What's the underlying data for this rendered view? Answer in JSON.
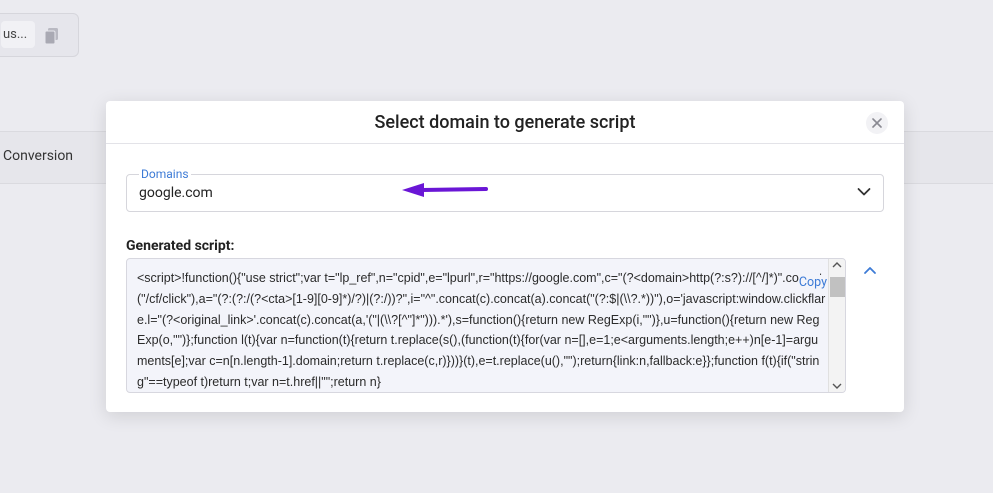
{
  "background": {
    "field_text": "us...",
    "row_label": "Conversion"
  },
  "modal": {
    "title": "Select domain to generate script",
    "domains_label": "Domains",
    "selected_domain": "google.com",
    "generated_label": "Generated script:",
    "copy_label": "Copy",
    "script_text": "<script>!function(){\"use strict\";var t=\"lp_ref\",n=\"cpid\",e=\"lpurl\",r=\"https://google.com\",c=\"(?<domain>http(?:s?)://[^/]*)\".concat(\"/cf/click\"),a=\"(?:(?:/(?<cta>[1-9][0-9]*)/?)|(?:/))?\",i=\"^\".concat(c).concat(a).concat(\"(?:$|(\\\\?.*))\"),o='javascript:window.clickflare.l=\"(?<original_link>'.concat(c).concat(a,'(\"|(\\\\?[^\"]*\"))).*'),s=function(){return new RegExp(i,\"\")},u=function(){return new RegExp(o,\"\")};function l(t){var n=function(t){return t.replace(s(),(function(t){for(var n=[],e=1;e<arguments.length;e++)n[e-1]=arguments[e];var c=n[n.length-1].domain;return t.replace(c,r)}))}(t),e=t.replace(u(),\"\");return{link:n,fallback:e}};function f(t){if(\"string\"==typeof t)return t;var n=t.href||\"\";return n}"
  },
  "colors": {
    "accent": "#3d7bd6",
    "annotation_arrow": "#6a16d6"
  }
}
